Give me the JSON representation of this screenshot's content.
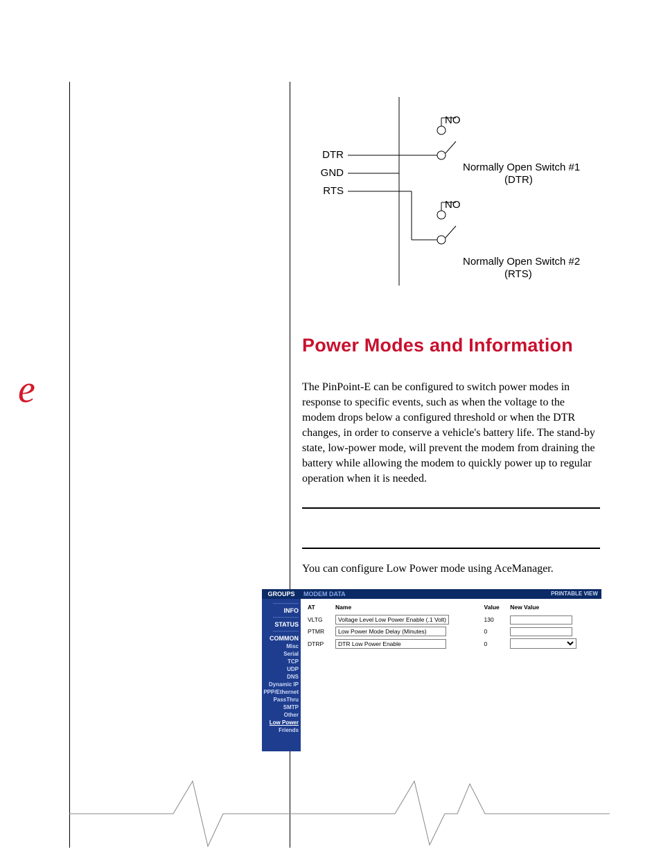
{
  "brand_glyph": "e",
  "diagram": {
    "labels": {
      "dtr": "DTR",
      "gnd": "GND",
      "rts": "RTS",
      "no1": "NO",
      "no2": "NO",
      "sw1_line1": "Normally Open Switch #1",
      "sw1_line2": "(DTR)",
      "sw2_line1": "Normally Open Switch #2",
      "sw2_line2": "(RTS)"
    }
  },
  "heading": "Power Modes and Information",
  "paragraph1": "The PinPoint-E can be configured to switch power modes in response to specific events, such as when the voltage to the modem drops below a configured threshold or when the DTR changes, in order to conserve a vehicle's battery life. The stand-by state, low-power mode, will prevent the modem from draining the battery while allowing the modem to quickly power up to regular operation when it is needed.",
  "paragraph2": "You can configure Low Power mode using AceManager.",
  "app": {
    "groups_label": "GROUPS",
    "modem_data_label": "MODEM DATA",
    "printable_label": "PRINTABLE VIEW",
    "side": {
      "info": "INFO",
      "status": "STATUS",
      "common": "COMMON",
      "items": [
        "Misc",
        "Serial",
        "TCP",
        "UDP",
        "DNS",
        "Dynamic IP",
        "PPP/Ethernet",
        "PassThru",
        "SMTP",
        "Other",
        "Low Power",
        "Friends"
      ],
      "active_index": 10
    },
    "table": {
      "headers": {
        "at": "AT",
        "name": "Name",
        "value": "Value",
        "new_value": "New Value"
      },
      "rows": [
        {
          "at": "VLTG",
          "name": "Voltage Level Low Power Enable (.1 Volt)",
          "value": "130",
          "new_value": "",
          "kind": "text"
        },
        {
          "at": "PTMR",
          "name": "Low Power Mode Delay (Minutes)",
          "value": "0",
          "new_value": "",
          "kind": "text"
        },
        {
          "at": "DTRP",
          "name": "DTR Low Power Enable",
          "value": "0",
          "new_value": "",
          "kind": "select"
        }
      ]
    }
  }
}
